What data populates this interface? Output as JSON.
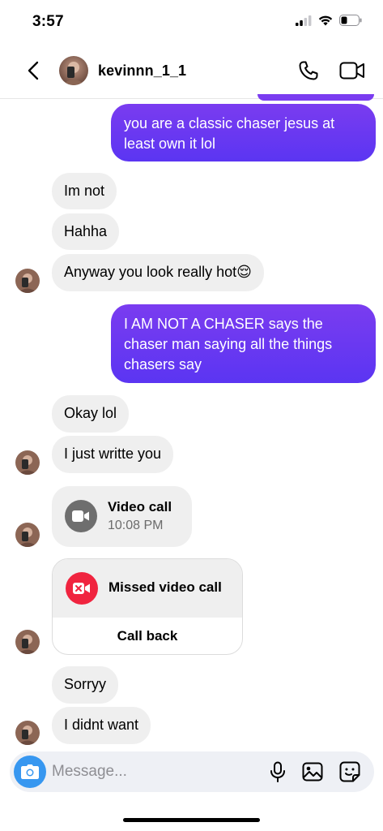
{
  "status_bar": {
    "time": "3:57"
  },
  "header": {
    "username": "kevinnn_1_1",
    "avatar_icon": "profile-photo",
    "back_icon": "chevron-left-icon",
    "call_icon": "phone-icon",
    "video_icon": "video-camera-icon"
  },
  "messages": [
    {
      "id": "m1",
      "sender": "me",
      "text": "you are a classic chaser jesus at least own it lol"
    },
    {
      "id": "m2",
      "sender": "them",
      "text": "Im not"
    },
    {
      "id": "m3",
      "sender": "them",
      "text": "Hahha"
    },
    {
      "id": "m4",
      "sender": "them",
      "text": "Anyway you look really hot😌"
    },
    {
      "id": "m5",
      "sender": "me",
      "text": "I AM NOT A CHASER says the chaser man saying all the things chasers say"
    },
    {
      "id": "m6",
      "sender": "them",
      "text": "Okay lol"
    },
    {
      "id": "m7",
      "sender": "them",
      "text": "I just writte you"
    },
    {
      "id": "m10",
      "sender": "them",
      "text": "Sorryy"
    },
    {
      "id": "m11",
      "sender": "them",
      "text": "I didnt want"
    }
  ],
  "video_call": {
    "title": "Video call",
    "time": "10:08 PM"
  },
  "missed_call": {
    "title": "Missed video call",
    "action": "Call back"
  },
  "composer": {
    "placeholder": "Message..."
  },
  "colors": {
    "outgoing_top": "#7a3cf0",
    "outgoing_bottom": "#5b35f2",
    "incoming_bg": "#efefef",
    "missed_red": "#f0243f",
    "camera_blue": "#3797f0"
  }
}
